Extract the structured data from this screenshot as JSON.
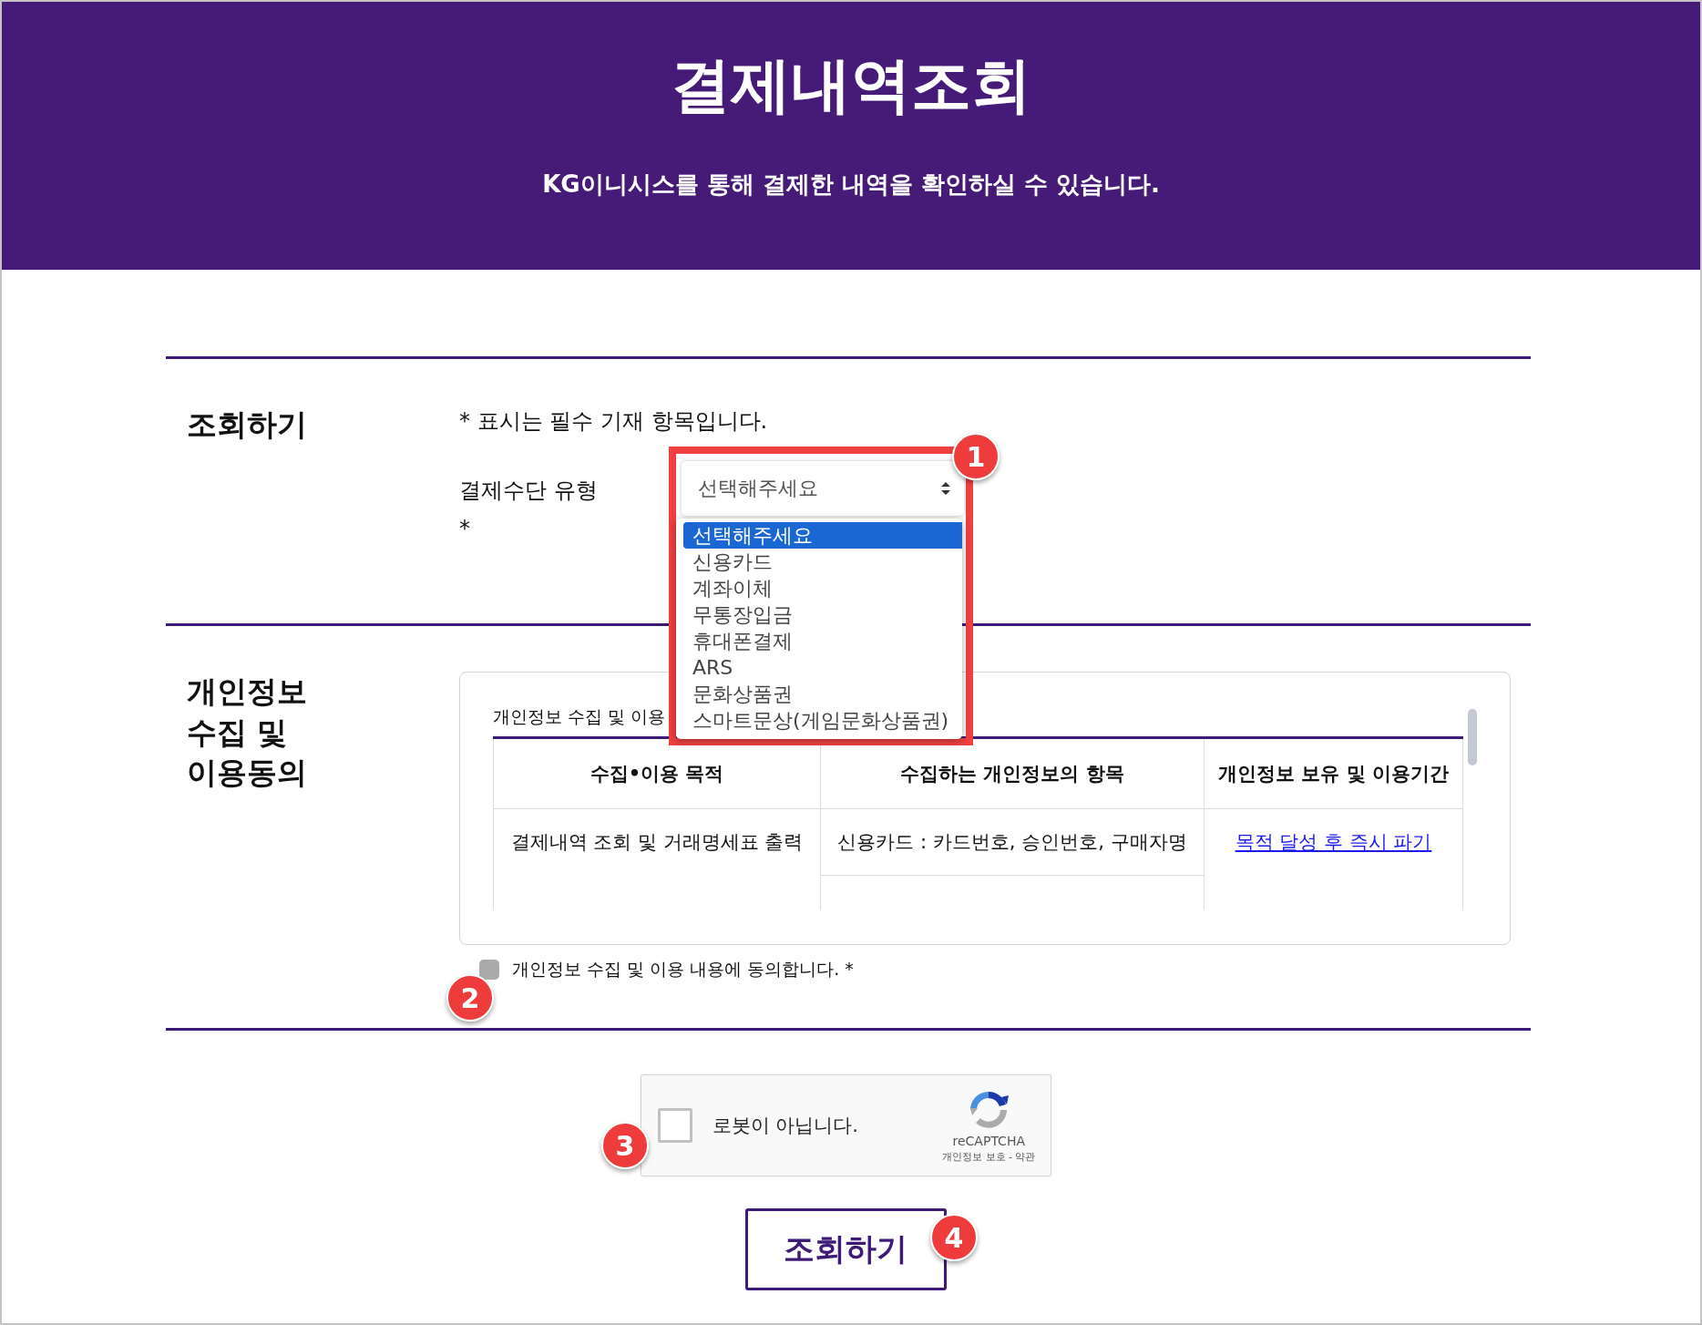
{
  "header": {
    "title": "결제내역조회",
    "subtitle": "KG이니시스를 통해 결제한 내역을 확인하실 수 있습니다."
  },
  "lookup": {
    "heading": "조회하기",
    "note": "* 표시는 필수 기재 항목입니다.",
    "field_label": "결제수단 유형",
    "required_mark": "*",
    "select": {
      "value": "선택해주세요",
      "expanded": true,
      "options": [
        {
          "label": "선택해주세요",
          "selected": true
        },
        {
          "label": "신용카드",
          "selected": false
        },
        {
          "label": "계좌이체",
          "selected": false
        },
        {
          "label": "무통장입금",
          "selected": false
        },
        {
          "label": "휴대폰결제",
          "selected": false
        },
        {
          "label": "ARS",
          "selected": false
        },
        {
          "label": "문화상품권",
          "selected": false
        },
        {
          "label": "스마트문상(게임문화상품권)",
          "selected": false
        }
      ]
    }
  },
  "consent": {
    "heading": "개인정보\n수집 및\n이용동의",
    "box_title": "개인정보 수집 및 이용",
    "table": {
      "columns": [
        "수집•이용 목적",
        "수집하는 개인정보의 항목",
        "개인정보 보유 및 이용기간"
      ],
      "rows": [
        {
          "purpose": "결제내역 조회 및 거래명세표 출력",
          "items": "신용카드 : 카드번호, 승인번호, 구매자명",
          "retention": "목적 달성 후 즉시 파기"
        }
      ]
    },
    "agree": {
      "label": "개인정보 수집 및 이용 내용에 동의합니다. *",
      "checked": false
    }
  },
  "captcha": {
    "label": "로봇이 아닙니다.",
    "checked": false,
    "brand": "reCAPTCHA",
    "links": "개인정보 보호 - 약관"
  },
  "submit": {
    "label": "조회하기"
  },
  "annotations": [
    {
      "number": "1"
    },
    {
      "number": "2"
    },
    {
      "number": "3"
    },
    {
      "number": "4"
    }
  ]
}
